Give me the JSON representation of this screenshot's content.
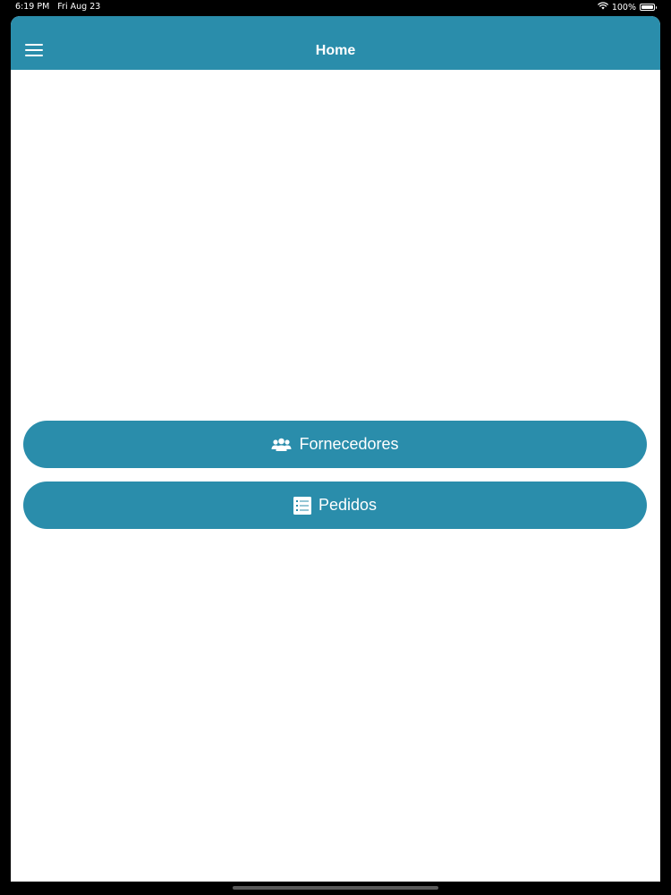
{
  "status_bar": {
    "time": "6:19 PM",
    "date": "Fri Aug 23",
    "battery_text": "100%"
  },
  "nav": {
    "title": "Home",
    "menu_icon": "hamburger-menu-icon"
  },
  "buttons": [
    {
      "label": "Fornecedores",
      "icon": "users-group-icon"
    },
    {
      "label": "Pedidos",
      "icon": "list-icon"
    }
  ],
  "colors": {
    "primary": "#2a8dab",
    "background": "#ffffff",
    "frame": "#000000"
  }
}
